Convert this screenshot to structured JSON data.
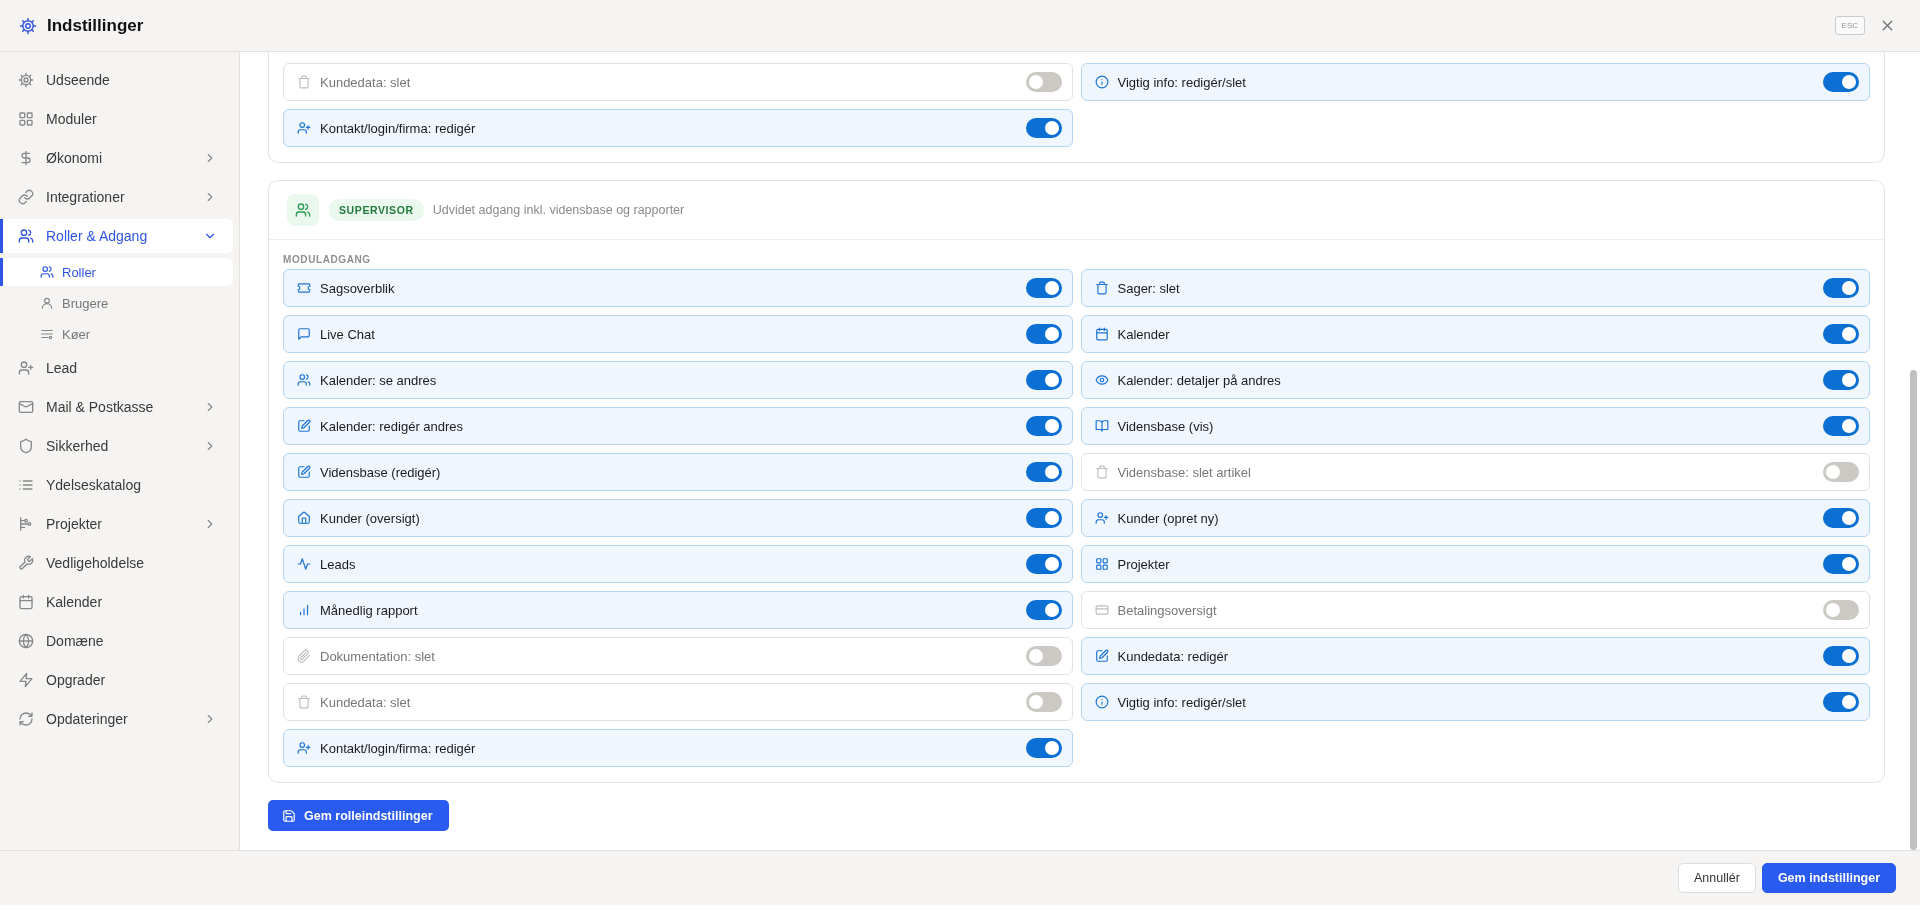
{
  "window": {
    "title": "Indstillinger",
    "esc_hint": "ESC"
  },
  "sidebar": {
    "items": [
      {
        "label": "Udseende",
        "selected": false
      },
      {
        "label": "Moduler",
        "selected": false
      },
      {
        "label": "Økonomi",
        "selected": false,
        "expanded": false
      },
      {
        "label": "Integrationer",
        "selected": false,
        "expanded": false
      },
      {
        "label": "Roller & Adgang",
        "selected": true,
        "expanded": true,
        "children": [
          {
            "label": "Roller",
            "selected": true
          },
          {
            "label": "Brugere",
            "selected": false
          },
          {
            "label": "Køer",
            "selected": false
          }
        ]
      },
      {
        "label": "Lead",
        "selected": false
      },
      {
        "label": "Mail & Postkasse",
        "selected": false,
        "expanded": false
      },
      {
        "label": "Sikkerhed",
        "selected": false,
        "expanded": false
      },
      {
        "label": "Ydelseskatalog",
        "selected": false
      },
      {
        "label": "Projekter",
        "selected": false,
        "expanded": false
      },
      {
        "label": "Vedligeholdelse",
        "selected": false
      },
      {
        "label": "Kalender",
        "selected": false
      },
      {
        "label": "Domæne",
        "selected": false
      },
      {
        "label": "Opgrader",
        "selected": false
      },
      {
        "label": "Opdateringer",
        "selected": false,
        "expanded": false
      }
    ]
  },
  "role_cards": [
    {
      "permissions": [
        {
          "label": "Kundedata: slet",
          "on": false
        },
        {
          "label": "Vigtig info: redigér/slet",
          "on": true
        },
        {
          "label": "Kontakt/login/firma: redigér",
          "on": true
        }
      ]
    },
    {
      "role": {
        "badge": "SUPERVISOR",
        "description": "Udvidet adgang inkl. vidensbase og rapporter"
      },
      "section_label": "MODULADGANG",
      "permissions": [
        {
          "label": "Sagsoverblik",
          "on": true
        },
        {
          "label": "Sager: slet",
          "on": true
        },
        {
          "label": "Live Chat",
          "on": true
        },
        {
          "label": "Kalender",
          "on": true
        },
        {
          "label": "Kalender: se andres",
          "on": true
        },
        {
          "label": "Kalender: detaljer på andres",
          "on": true
        },
        {
          "label": "Kalender: redigér andres",
          "on": true
        },
        {
          "label": "Vidensbase (vis)",
          "on": true
        },
        {
          "label": "Vidensbase (redigér)",
          "on": true
        },
        {
          "label": "Vidensbase: slet artikel",
          "on": false
        },
        {
          "label": "Kunder (oversigt)",
          "on": true
        },
        {
          "label": "Kunder (opret ny)",
          "on": true
        },
        {
          "label": "Leads",
          "on": true
        },
        {
          "label": "Projekter",
          "on": true
        },
        {
          "label": "Månedlig rapport",
          "on": true
        },
        {
          "label": "Betalingsoversigt",
          "on": false
        },
        {
          "label": "Dokumentation: slet",
          "on": false
        },
        {
          "label": "Kundedata: redigér",
          "on": true
        },
        {
          "label": "Kundedata: slet",
          "on": false
        },
        {
          "label": "Vigtig info: redigér/slet",
          "on": true
        },
        {
          "label": "Kontakt/login/firma: redigér",
          "on": true
        }
      ]
    }
  ],
  "save_role_button": "Gem rolleindstillinger",
  "footer": {
    "buttons": [
      {
        "label": "Annullér",
        "kind": "secondary"
      },
      {
        "label": "Gem indstillinger",
        "kind": "primary"
      }
    ]
  }
}
